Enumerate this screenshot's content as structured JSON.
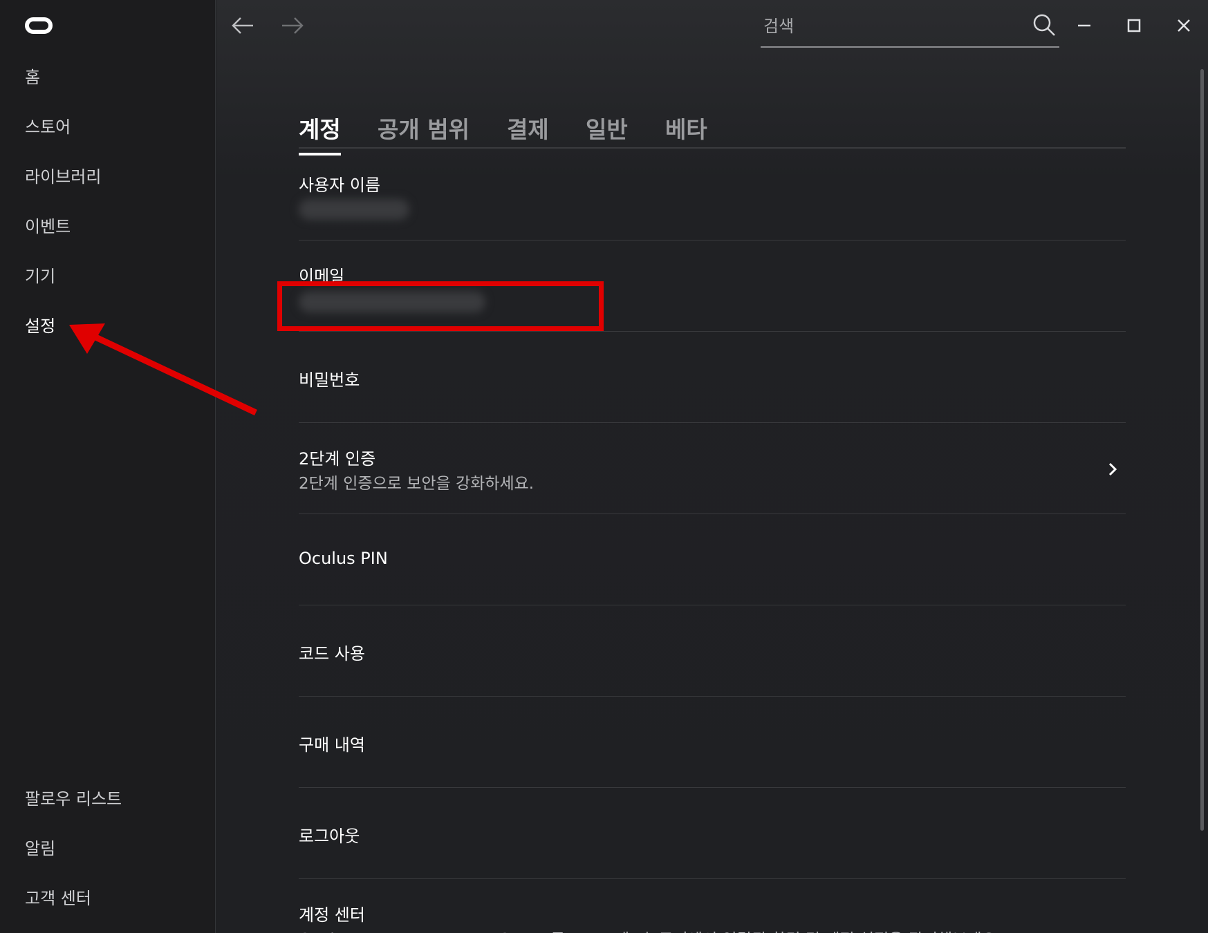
{
  "sidebar": {
    "items": [
      {
        "label": "홈"
      },
      {
        "label": "스토어"
      },
      {
        "label": "라이브러리"
      },
      {
        "label": "이벤트"
      },
      {
        "label": "기기"
      },
      {
        "label": "설정"
      }
    ],
    "bottom_items": [
      {
        "label": "팔로우 리스트"
      },
      {
        "label": "알림"
      },
      {
        "label": "고객 센터"
      }
    ],
    "active": "설정"
  },
  "search": {
    "placeholder": "검색",
    "value": ""
  },
  "tabs": [
    {
      "label": "계정",
      "active": true
    },
    {
      "label": "공개 범위"
    },
    {
      "label": "결제"
    },
    {
      "label": "일반"
    },
    {
      "label": "베타"
    }
  ],
  "settings": {
    "username": {
      "title": "사용자 이름"
    },
    "email": {
      "title": "이메일"
    },
    "password": {
      "title": "비밀번호"
    },
    "two_factor": {
      "title": "2단계 인증",
      "subtitle": "2단계 인증으로 보안을 강화하세요."
    },
    "pin": {
      "title": "Oculus PIN"
    },
    "redeem": {
      "title": "코드 사용"
    },
    "purchases": {
      "title": "구매 내역"
    },
    "logout": {
      "title": "로그아웃"
    },
    "account_center": {
      "title": "계정 센터",
      "subtitle": "Oculus, Instagram, Meta Quest 등 Meta 테크놀로지에서 연결된 환경 및 계정 설정을 관리해보세요."
    }
  },
  "annotation": {
    "highlight_color": "#e00000"
  },
  "colors": {
    "background": "#202124",
    "sidebar": "#1c1c1e",
    "accent": "#ffffff"
  }
}
